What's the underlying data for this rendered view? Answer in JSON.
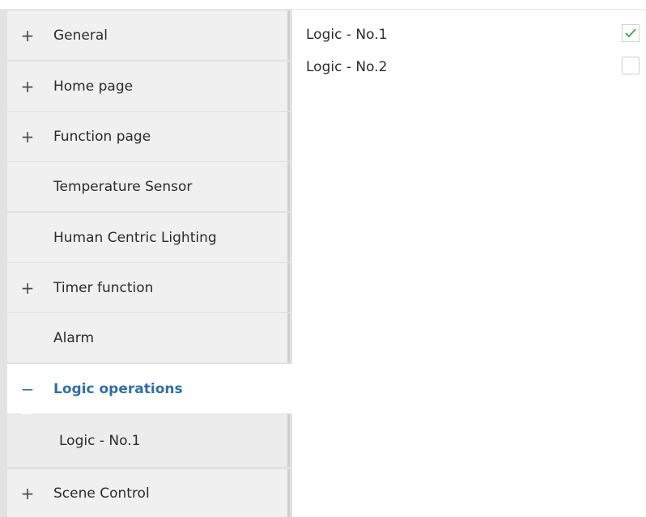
{
  "sidebar": {
    "items": [
      {
        "label": "General",
        "expander": "+"
      },
      {
        "label": "Home page",
        "expander": "+"
      },
      {
        "label": "Function page",
        "expander": "+"
      },
      {
        "label": "Temperature Sensor",
        "expander": ""
      },
      {
        "label": "Human Centric Lighting",
        "expander": ""
      },
      {
        "label": "Timer function",
        "expander": "+"
      },
      {
        "label": "Alarm",
        "expander": ""
      },
      {
        "label": "Logic operations",
        "expander": "−",
        "selected": true
      },
      {
        "label": "Logic  - No.1",
        "expander": "",
        "sub_item": true
      },
      {
        "label": "Scene Control",
        "expander": "+"
      }
    ]
  },
  "content": {
    "options": [
      {
        "label": "Logic  - No.1",
        "checked": true
      },
      {
        "label": "Logic  - No.2",
        "checked": false
      }
    ]
  },
  "colors": {
    "accent": "#2f6fa8",
    "check": "#4caf50"
  }
}
